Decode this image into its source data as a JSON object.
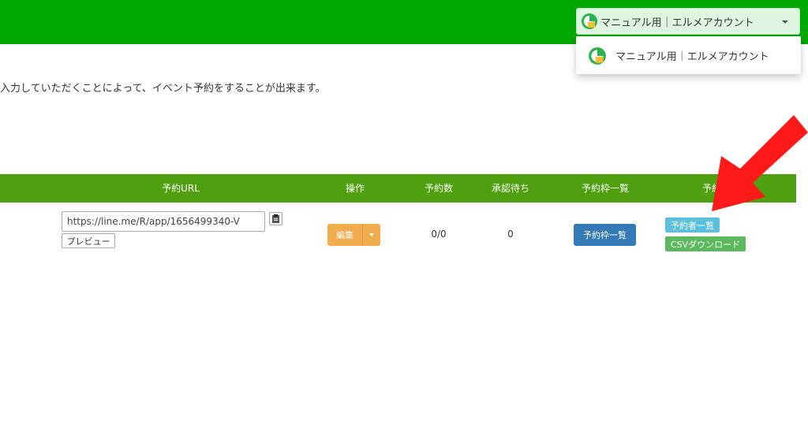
{
  "header": {
    "account_label": "マニュアル用｜エルメアカウント",
    "brand_color": "#00a700"
  },
  "dropdown": {
    "items": [
      {
        "label": "マニュアル用｜エルメアカウント"
      }
    ]
  },
  "description": "入力していただくことによって、イベント予約をすることが出来ます。",
  "table": {
    "header_color": "#4ea00f",
    "columns": [
      "予約URL",
      "操作",
      "予約数",
      "承認待ち",
      "予約枠一覧",
      "予約"
    ],
    "rows": [
      {
        "url_value": "https://line.me/R/app/1656499340-V",
        "preview_label": "プレビュー",
        "edit_label": "編集",
        "reservations": "0/0",
        "pending": "0",
        "slot_list_label": "予約枠一覧",
        "reservers_label": "予約者一覧",
        "csv_label": "CSVダウンロード"
      }
    ]
  },
  "icons": {
    "account_logo": "brand-logo-icon",
    "copy": "clipboard-icon",
    "caret": "chevron-down-icon",
    "annotation": "red-arrow-icon"
  }
}
